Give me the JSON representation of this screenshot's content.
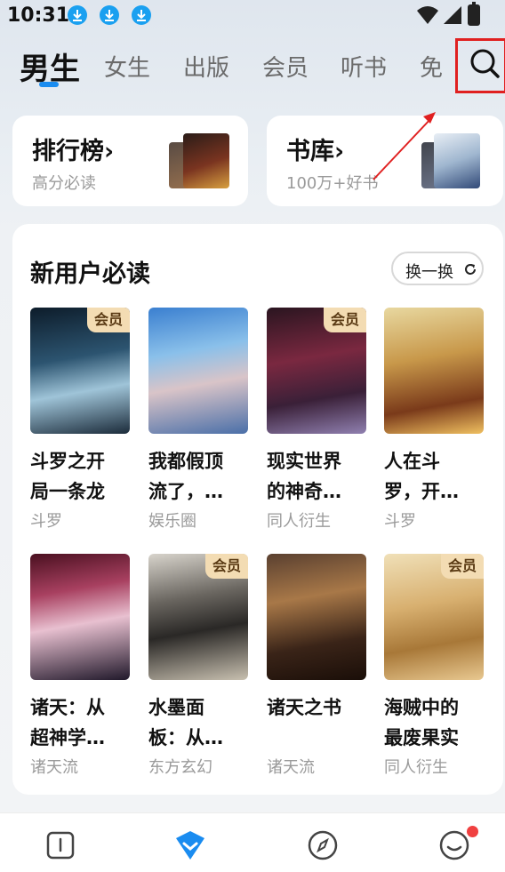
{
  "status_bar": {
    "time": "10:31"
  },
  "tabs": [
    {
      "label": "男生",
      "active": true
    },
    {
      "label": "女生"
    },
    {
      "label": "出版"
    },
    {
      "label": "会员"
    },
    {
      "label": "听书"
    },
    {
      "label": "免"
    }
  ],
  "top_cards": {
    "ranking": {
      "title": "排行榜",
      "arrow": "›",
      "subtitle": "高分必读"
    },
    "library": {
      "title": "书库",
      "arrow": "›",
      "subtitle": "100万+好书"
    }
  },
  "section": {
    "title": "新用户必读",
    "refresh_label": "换一换"
  },
  "vip_label": "会员",
  "books": [
    {
      "title": "斗罗之开局一条龙",
      "display_title": "斗罗之开\n局一条龙",
      "category": "斗罗",
      "vip": true
    },
    {
      "title": "我都假顶流了，…",
      "display_title": "我都假顶\n流了，…",
      "category": "娱乐圈",
      "vip": false
    },
    {
      "title": "现实世界的神奇…",
      "display_title": "现实世界\n的神奇…",
      "category": "同人衍生",
      "vip": true
    },
    {
      "title": "人在斗罗，开…",
      "display_title": "人在斗\n罗，开…",
      "category": "斗罗",
      "vip": false
    },
    {
      "title": "诸天：从超神学…",
      "display_title": "诸天：从\n超神学…",
      "category": "诸天流",
      "vip": false
    },
    {
      "title": "水墨面板：从…",
      "display_title": "水墨面\n板：从…",
      "category": "东方玄幻",
      "vip": true
    },
    {
      "title": "诸天之书",
      "display_title": "诸天之书",
      "category": "诸天流",
      "vip": false
    },
    {
      "title": "海贼中的最废果实",
      "display_title": "海贼中的\n最废果实",
      "category": "同人衍生",
      "vip": true
    }
  ],
  "colors": {
    "accent": "#1a8cf0",
    "annotation": "#e02020",
    "vip_bg": "#f3dcb3"
  },
  "icons": {
    "status": [
      "download-icon",
      "wifi-icon",
      "signal-icon",
      "battery-icon"
    ],
    "nav": [
      "bookshelf-icon",
      "bookstore-icon",
      "discover-icon",
      "profile-icon"
    ]
  }
}
